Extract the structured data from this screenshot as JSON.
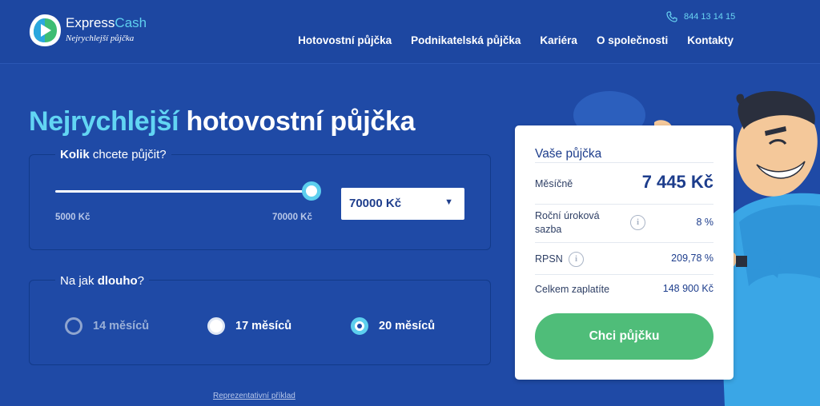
{
  "brand": {
    "name_part1": "Express",
    "name_part2": "Cash",
    "tagline": "Nejrychlejší půjčka"
  },
  "header": {
    "phone": "844 13 14 15",
    "nav": [
      {
        "label": "Hotovostní půjčka"
      },
      {
        "label": "Podnikatelská půjčka"
      },
      {
        "label": "Kariéra"
      },
      {
        "label": "O společnosti"
      },
      {
        "label": "Kontakty"
      }
    ]
  },
  "hero": {
    "title_highlight": "Nejrychlejší",
    "title_rest": " hotovostní půjčka"
  },
  "amount": {
    "label_bold": "Kolik",
    "label_rest": " chcete půjčit?",
    "min_label": "5000 Kč",
    "max_label": "70000 Kč",
    "selected": "70000 Kč",
    "slider_fraction": 1.0
  },
  "term": {
    "label_rest": "Na jak ",
    "label_bold": "dlouho",
    "label_end": "?",
    "options": [
      {
        "label": "14 měsíců",
        "state": "disabled"
      },
      {
        "label": "17 měsíců",
        "state": "unselected"
      },
      {
        "label": "20 měsíců",
        "state": "selected"
      }
    ]
  },
  "representative_link": "Reprezentativní příklad",
  "summary": {
    "title": "Vaše půjčka",
    "monthly_label": "Měsíčně",
    "monthly_value": "7 445 Kč",
    "rate_label_line1": "Roční úroková",
    "rate_label_line2": "sazba",
    "rate_value": "8 %",
    "rpsn_label": "RPSN",
    "rpsn_value": "209,78 %",
    "total_label": "Celkem zaplatíte",
    "total_value": "148 900 Kč",
    "cta": "Chci půjčku",
    "info_glyph": "i"
  },
  "colors": {
    "background": "#1f4aa6",
    "accent": "#5ccfee",
    "cta": "#4fbd79"
  }
}
